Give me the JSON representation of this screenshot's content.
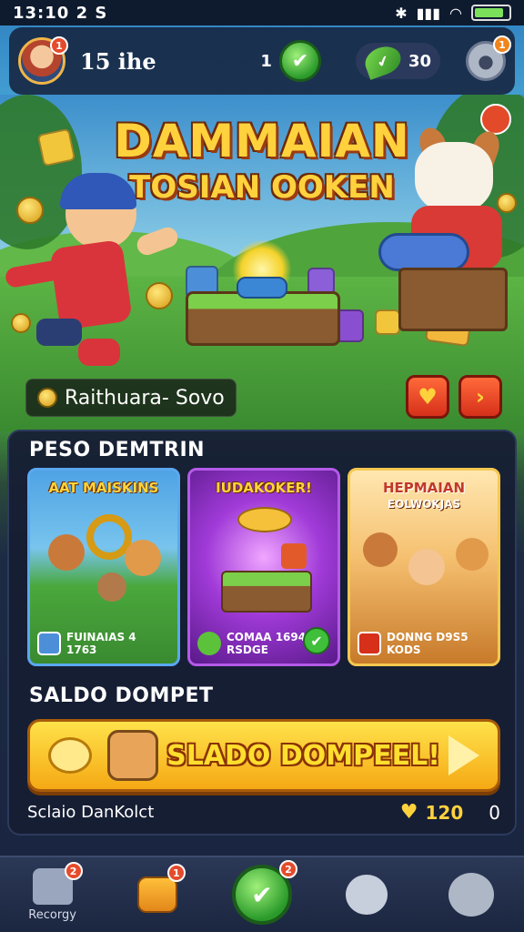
{
  "status_bar": {
    "time": "13:10  2 S",
    "bluetooth_icon": "bluetooth-icon",
    "signal_icon": "signal-icon",
    "wifi_icon": "wifi-icon",
    "battery_level": 0.85
  },
  "top_bar": {
    "avatar_badge": "1",
    "username": "15 ihe",
    "counter_value": "1",
    "leaf_value": "30",
    "settings_badge": "1"
  },
  "hero": {
    "title_line1": "DAMMAIAN",
    "title_line2": "TOSIAN OOKEN",
    "location_name": "Raithuara- Sovo"
  },
  "panel": {
    "section1_title": "PESO DEMTRIN",
    "cards": [
      {
        "title": "AAT MAISKINS",
        "footer_line1": "FUINAIAS 4",
        "footer_line2": "1763",
        "accent": "#3c8ad6"
      },
      {
        "title": "IUDAKOKER!",
        "footer_line1": "COMAA 1694",
        "footer_line2": "RSDGE",
        "accent": "#9c3fd6"
      },
      {
        "title": "HEPMAIAN",
        "subtitle": "EOLWOKJAS",
        "footer_line1": "DONNG D9S5",
        "footer_line2": "KODS",
        "accent": "#f0b63a"
      }
    ],
    "section2_title": "SALDO DOMPET",
    "wallet_button_label": "SLADO DOMPEEL!",
    "wallet_label": "Sclaio DanKolct",
    "wallet_amount": "120",
    "wallet_extra": "0"
  },
  "bottom_nav": [
    {
      "label": "Recorgy",
      "badge": "2",
      "icon": "home-icon"
    },
    {
      "label": "",
      "badge": "1",
      "icon": "shop-icon"
    },
    {
      "label": "",
      "badge": "2",
      "icon": "play-icon"
    },
    {
      "label": "",
      "badge": "",
      "icon": "chat-icon"
    },
    {
      "label": "",
      "badge": "",
      "icon": "profile-icon"
    }
  ]
}
